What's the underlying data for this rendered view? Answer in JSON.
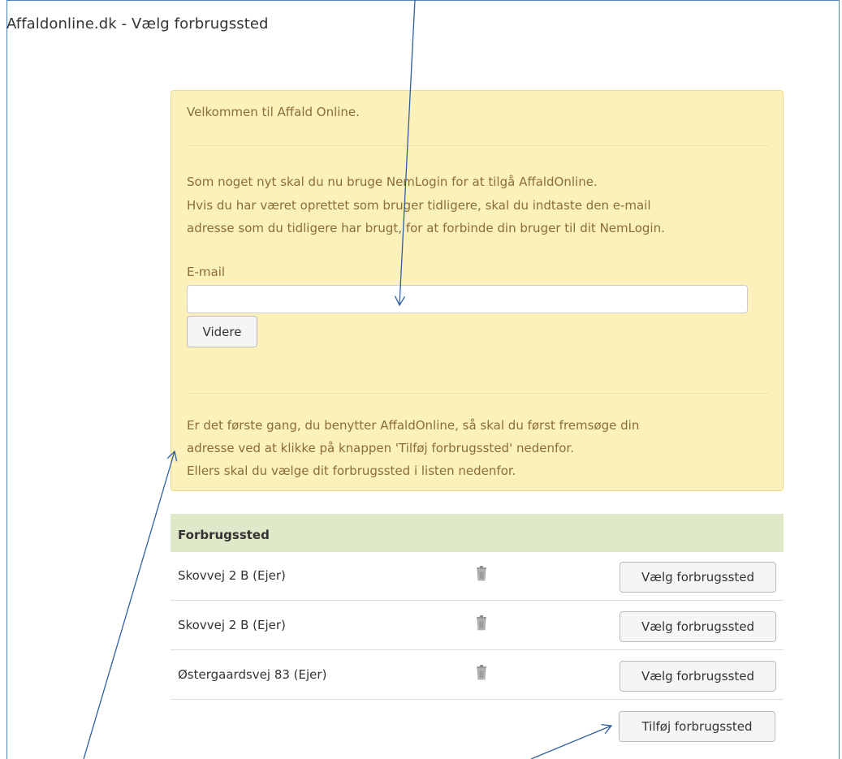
{
  "page": {
    "title": "Affaldonline.dk - Vælg forbrugssted"
  },
  "alert": {
    "welcome": "Velkommen til Affald Online.",
    "info_lines": [
      "Som noget nyt skal du nu bruge NemLogin for at tilgå AffaldOnline.",
      "Hvis du har været oprettet som bruger tidligere, skal du indtaste den e-mail",
      "adresse som du tidligere har brugt, for at forbinde din bruger til dit NemLogin."
    ],
    "email_label": "E-mail",
    "email_value": "",
    "continue_label": "Videre",
    "footer_lines": [
      "Er det første gang, du benytter AffaldOnline, så skal du først fremsøge din",
      "adresse ved at klikke på knappen 'Tilføj forbrugssted' nedenfor.",
      "Ellers skal du vælge dit forbrugssted i listen nedenfor."
    ]
  },
  "table": {
    "header": "Forbrugssted",
    "rows": [
      {
        "address": "Skovvej 2 B (Ejer)",
        "icon": "trash-icon",
        "button": "Vælg forbrugssted"
      },
      {
        "address": "Skovvej 2 B (Ejer)",
        "icon": "trash-icon",
        "button": "Vælg forbrugssted"
      },
      {
        "address": "Østergaardsvej 83 (Ejer)",
        "icon": "trash-icon",
        "button": "Vælg forbrugssted"
      }
    ],
    "add_button": "Tilføj forbrugssted"
  },
  "colors": {
    "alert_bg": "#fcf0bb",
    "alert_text": "#8a6d3b",
    "table_header_bg": "#dfe8c8",
    "annotation_arrow": "#2e5f9e"
  }
}
